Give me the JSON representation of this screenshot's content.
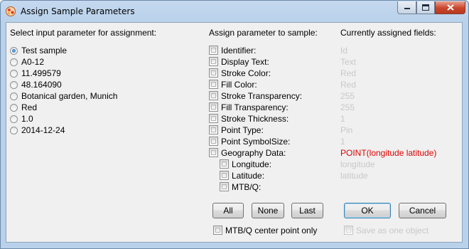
{
  "window": {
    "title": "Assign Sample Parameters"
  },
  "headers": {
    "input": "Select input parameter for assignment:",
    "assign": "Assign parameter to sample:",
    "current": "Currently assigned fields:"
  },
  "input_params": [
    {
      "label": "Test sample",
      "selected": true
    },
    {
      "label": "A0-12",
      "selected": false
    },
    {
      "label": "11.499579",
      "selected": false
    },
    {
      "label": "48.164090",
      "selected": false
    },
    {
      "label": "Botanical garden, Munich",
      "selected": false
    },
    {
      "label": "Red",
      "selected": false
    },
    {
      "label": "1.0",
      "selected": false
    },
    {
      "label": "2014-12-24",
      "selected": false
    }
  ],
  "fields": [
    {
      "label": "Identifier:",
      "value": "Id",
      "checked": false
    },
    {
      "label": "Display Text:",
      "value": "Text",
      "checked": false
    },
    {
      "label": "Stroke Color:",
      "value": "Red",
      "checked": false
    },
    {
      "label": "Fill Color:",
      "value": "Red",
      "checked": false
    },
    {
      "label": "Stroke Transparency:",
      "value": "255",
      "checked": false
    },
    {
      "label": "Fill Transparency:",
      "value": "255",
      "checked": false
    },
    {
      "label": "Stroke Thickness:",
      "value": "1",
      "checked": false
    },
    {
      "label": "Point Type:",
      "value": "Pin",
      "checked": false
    },
    {
      "label": "Point SymbolSize:",
      "value": "1",
      "checked": false
    },
    {
      "label": "Geography Data:",
      "value": "POINT(longitude latitude)",
      "checked": false,
      "highlight_color": "#e00000"
    }
  ],
  "geo_subfields": [
    {
      "label": "Longitude:",
      "value": "longitude",
      "checked": false
    },
    {
      "label": "Latitude:",
      "value": "latitude",
      "checked": false
    },
    {
      "label": "MTB/Q:",
      "value": "",
      "checked": false
    }
  ],
  "buttons": {
    "all": "All",
    "none": "None",
    "last": "Last",
    "ok": "OK",
    "cancel": "Cancel"
  },
  "options": {
    "mtbq_center": {
      "label": "MTB/Q center point only",
      "checked": false
    },
    "save_one": {
      "label": "Save as one object",
      "checked": false,
      "enabled": false
    }
  },
  "icons": {
    "app": "app-icon",
    "minimize": "minimize-icon",
    "maximize": "maximize-icon",
    "close": "close-icon"
  },
  "colors": {
    "highlight": "#e00000",
    "disabled_text": "#c8c8c8",
    "titlebar": "#b9d1ea"
  }
}
